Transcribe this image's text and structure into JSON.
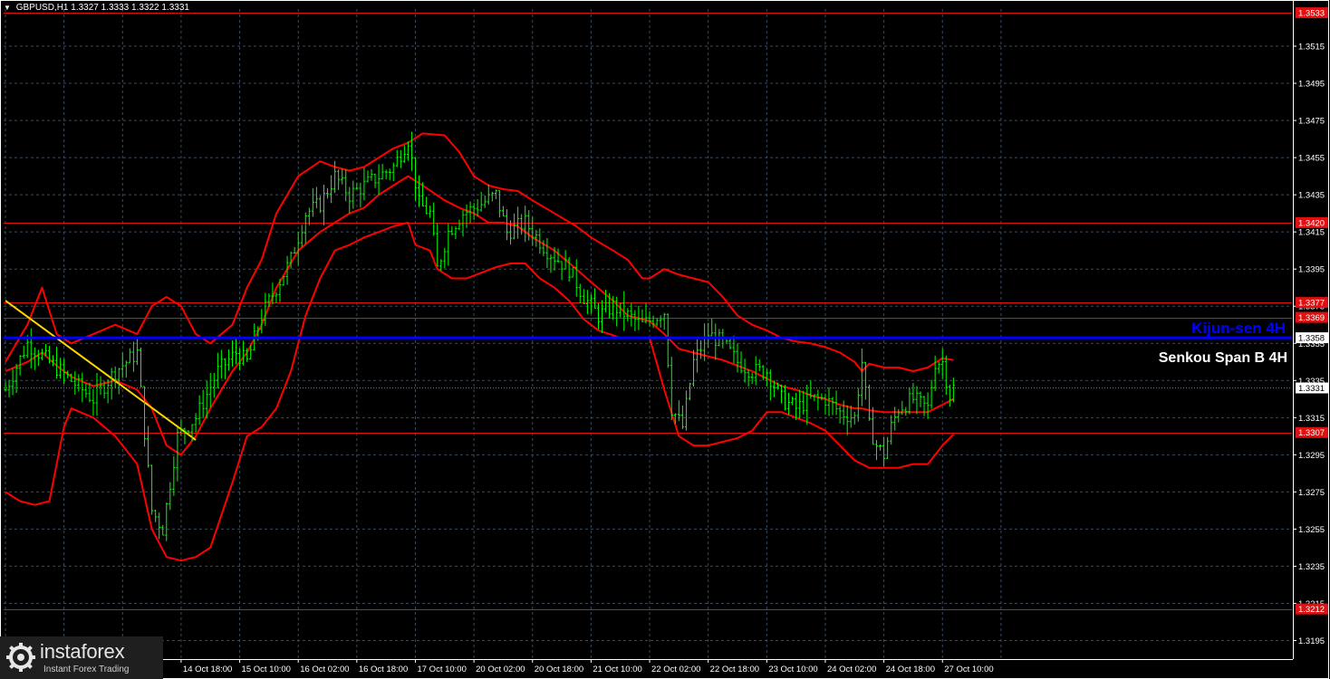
{
  "header": {
    "symbol": "GBPUSD,H1",
    "ohlc": "1.3327 1.3333 1.3322 1.3331"
  },
  "logo": {
    "name": "instaforex",
    "tagline": "Instant Forex Trading"
  },
  "chart_data": {
    "type": "candlestick",
    "symbol": "GBPUSD",
    "timeframe": "H1",
    "ylim": [
      1.3185,
      1.3535
    ],
    "grid": true,
    "background": "#000000",
    "colors": {
      "candles": "#00ff00",
      "indicator": "#ff0000",
      "level": "#e01010",
      "kijun": "#0000ff",
      "trendline": "#ffd700",
      "grid": "#3c4a5a",
      "axis_text": "#ffffff",
      "level_label_bg": "#e01010",
      "current_label_bg": "#ffffff"
    },
    "y_ticks": [
      "1.3195",
      "1.3215",
      "1.3235",
      "1.3255",
      "1.3275",
      "1.3295",
      "1.3315",
      "1.3335",
      "1.3355",
      "1.3375",
      "1.3395",
      "1.3415",
      "1.3435",
      "1.3455",
      "1.3475",
      "1.3495",
      "1.3515"
    ],
    "x_labels": [
      {
        "label": "14 Oct 18:00",
        "bar": 48
      },
      {
        "label": "15 Oct 10:00",
        "bar": 64
      },
      {
        "label": "16 Oct 02:00",
        "bar": 80
      },
      {
        "label": "16 Oct 18:00",
        "bar": 96
      },
      {
        "label": "17 Oct 10:00",
        "bar": 112
      },
      {
        "label": "20 Oct 02:00",
        "bar": 128
      },
      {
        "label": "20 Oct 18:00",
        "bar": 144
      },
      {
        "label": "21 Oct 10:00",
        "bar": 160
      },
      {
        "label": "22 Oct 02:00",
        "bar": 176
      },
      {
        "label": "22 Oct 18:00",
        "bar": 192
      },
      {
        "label": "23 Oct 10:00",
        "bar": 208
      },
      {
        "label": "24 Oct 02:00",
        "bar": 224
      },
      {
        "label": "24 Oct 18:00",
        "bar": 240
      },
      {
        "label": "27 Oct 10:00",
        "bar": 256
      }
    ],
    "levels": [
      {
        "price": 1.3533,
        "label": "1.3533"
      },
      {
        "price": 1.342,
        "label": "1.3420"
      },
      {
        "price": 1.3377,
        "label": "1.3377"
      },
      {
        "price": 1.3369,
        "label": "1.3369"
      },
      {
        "price": 1.3307,
        "label": "1.3307"
      },
      {
        "price": 1.3212,
        "label": "1.3212"
      }
    ],
    "current_price": {
      "price": 1.3331,
      "label": "1.3331"
    },
    "kijun": {
      "price": 1.3358,
      "label": "1.3358"
    },
    "annotations": [
      "Kijun-sen 4H",
      "Senkou Span B 4H"
    ],
    "price_path": [
      [
        0,
        1.333
      ],
      [
        6,
        1.3355
      ],
      [
        12,
        1.3345
      ],
      [
        18,
        1.3335
      ],
      [
        24,
        1.3325
      ],
      [
        30,
        1.334
      ],
      [
        36,
        1.335
      ],
      [
        40,
        1.3265
      ],
      [
        43,
        1.3255
      ],
      [
        47,
        1.3305
      ],
      [
        52,
        1.3315
      ],
      [
        58,
        1.334
      ],
      [
        63,
        1.335
      ],
      [
        66,
        1.3345
      ],
      [
        70,
        1.337
      ],
      [
        74,
        1.3385
      ],
      [
        78,
        1.34
      ],
      [
        82,
        1.3425
      ],
      [
        86,
        1.343
      ],
      [
        90,
        1.3445
      ],
      [
        94,
        1.3435
      ],
      [
        98,
        1.344
      ],
      [
        102,
        1.3445
      ],
      [
        106,
        1.345
      ],
      [
        110,
        1.3465
      ],
      [
        113,
        1.343
      ],
      [
        116,
        1.3425
      ],
      [
        118,
        1.3395
      ],
      [
        121,
        1.3415
      ],
      [
        125,
        1.3425
      ],
      [
        130,
        1.343
      ],
      [
        134,
        1.3435
      ],
      [
        137,
        1.3415
      ],
      [
        142,
        1.342
      ],
      [
        148,
        1.3405
      ],
      [
        154,
        1.3395
      ],
      [
        158,
        1.338
      ],
      [
        162,
        1.337
      ],
      [
        166,
        1.3375
      ],
      [
        170,
        1.337
      ],
      [
        174,
        1.3365
      ],
      [
        180,
        1.3372
      ],
      [
        182,
        1.332
      ],
      [
        185,
        1.331
      ],
      [
        188,
        1.3345
      ],
      [
        192,
        1.336
      ],
      [
        196,
        1.3355
      ],
      [
        200,
        1.3345
      ],
      [
        204,
        1.334
      ],
      [
        208,
        1.334
      ],
      [
        212,
        1.3325
      ],
      [
        216,
        1.332
      ],
      [
        220,
        1.3325
      ],
      [
        224,
        1.3325
      ],
      [
        228,
        1.3318
      ],
      [
        232,
        1.3315
      ],
      [
        234,
        1.3345
      ],
      [
        236,
        1.331
      ],
      [
        238,
        1.33
      ],
      [
        240,
        1.3295
      ],
      [
        242,
        1.331
      ],
      [
        244,
        1.332
      ],
      [
        248,
        1.3325
      ],
      [
        252,
        1.332
      ],
      [
        254,
        1.3345
      ],
      [
        256,
        1.3345
      ],
      [
        258,
        1.3327
      ],
      [
        259,
        1.3331
      ]
    ],
    "bands": {
      "upper": [
        [
          0,
          1.3345
        ],
        [
          6,
          1.3365
        ],
        [
          10,
          1.3385
        ],
        [
          14,
          1.336
        ],
        [
          18,
          1.3355
        ],
        [
          24,
          1.336
        ],
        [
          30,
          1.3365
        ],
        [
          36,
          1.336
        ],
        [
          40,
          1.3375
        ],
        [
          44,
          1.338
        ],
        [
          48,
          1.3375
        ],
        [
          52,
          1.336
        ],
        [
          56,
          1.3355
        ],
        [
          62,
          1.3365
        ],
        [
          66,
          1.3385
        ],
        [
          70,
          1.34
        ],
        [
          74,
          1.3425
        ],
        [
          80,
          1.3445
        ],
        [
          86,
          1.3453
        ],
        [
          90,
          1.345
        ],
        [
          94,
          1.3448
        ],
        [
          98,
          1.345
        ],
        [
          102,
          1.3455
        ],
        [
          106,
          1.346
        ],
        [
          110,
          1.3463
        ],
        [
          114,
          1.3468
        ],
        [
          120,
          1.3467
        ],
        [
          124,
          1.3458
        ],
        [
          128,
          1.3445
        ],
        [
          132,
          1.344
        ],
        [
          136,
          1.3438
        ],
        [
          140,
          1.3437
        ],
        [
          144,
          1.3432
        ],
        [
          150,
          1.3425
        ],
        [
          156,
          1.3418
        ],
        [
          160,
          1.3412
        ],
        [
          166,
          1.3405
        ],
        [
          170,
          1.34
        ],
        [
          174,
          1.339
        ],
        [
          176,
          1.339
        ],
        [
          180,
          1.3395
        ],
        [
          184,
          1.3392
        ],
        [
          188,
          1.339
        ],
        [
          192,
          1.3388
        ],
        [
          196,
          1.338
        ],
        [
          200,
          1.337
        ],
        [
          204,
          1.3365
        ],
        [
          208,
          1.3362
        ],
        [
          212,
          1.3358
        ],
        [
          216,
          1.3356
        ],
        [
          220,
          1.3355
        ],
        [
          224,
          1.3353
        ],
        [
          228,
          1.335
        ],
        [
          232,
          1.3345
        ],
        [
          234,
          1.334
        ],
        [
          236,
          1.3344
        ],
        [
          240,
          1.3342
        ],
        [
          244,
          1.3342
        ],
        [
          248,
          1.334
        ],
        [
          252,
          1.3342
        ],
        [
          256,
          1.3347
        ],
        [
          259,
          1.3346
        ]
      ],
      "middle": [
        [
          0,
          1.334
        ],
        [
          6,
          1.3345
        ],
        [
          10,
          1.335
        ],
        [
          14,
          1.3343
        ],
        [
          18,
          1.3337
        ],
        [
          24,
          1.3332
        ],
        [
          30,
          1.3335
        ],
        [
          36,
          1.333
        ],
        [
          40,
          1.332
        ],
        [
          44,
          1.33
        ],
        [
          48,
          1.3295
        ],
        [
          52,
          1.3305
        ],
        [
          56,
          1.332
        ],
        [
          62,
          1.334
        ],
        [
          66,
          1.335
        ],
        [
          70,
          1.3365
        ],
        [
          74,
          1.3385
        ],
        [
          80,
          1.3405
        ],
        [
          86,
          1.3415
        ],
        [
          90,
          1.342
        ],
        [
          94,
          1.3425
        ],
        [
          98,
          1.3428
        ],
        [
          102,
          1.3435
        ],
        [
          106,
          1.344
        ],
        [
          110,
          1.3445
        ],
        [
          114,
          1.344
        ],
        [
          120,
          1.3432
        ],
        [
          124,
          1.3428
        ],
        [
          128,
          1.3425
        ],
        [
          132,
          1.342
        ],
        [
          136,
          1.342
        ],
        [
          140,
          1.3418
        ],
        [
          144,
          1.3412
        ],
        [
          150,
          1.3405
        ],
        [
          156,
          1.3395
        ],
        [
          160,
          1.3388
        ],
        [
          166,
          1.3378
        ],
        [
          170,
          1.337
        ],
        [
          174,
          1.3368
        ],
        [
          176,
          1.3367
        ],
        [
          180,
          1.336
        ],
        [
          184,
          1.3352
        ],
        [
          188,
          1.335
        ],
        [
          192,
          1.3348
        ],
        [
          196,
          1.3346
        ],
        [
          200,
          1.3343
        ],
        [
          204,
          1.334
        ],
        [
          208,
          1.3336
        ],
        [
          212,
          1.3332
        ],
        [
          216,
          1.333
        ],
        [
          220,
          1.3327
        ],
        [
          224,
          1.3325
        ],
        [
          228,
          1.3322
        ],
        [
          232,
          1.332
        ],
        [
          234,
          1.332
        ],
        [
          236,
          1.3319
        ],
        [
          240,
          1.3318
        ],
        [
          244,
          1.3318
        ],
        [
          248,
          1.3318
        ],
        [
          252,
          1.3318
        ],
        [
          256,
          1.3322
        ],
        [
          259,
          1.3325
        ]
      ],
      "lower": [
        [
          0,
          1.3275
        ],
        [
          4,
          1.327
        ],
        [
          8,
          1.3268
        ],
        [
          12,
          1.327
        ],
        [
          16,
          1.331
        ],
        [
          18,
          1.332
        ],
        [
          24,
          1.3315
        ],
        [
          30,
          1.3305
        ],
        [
          36,
          1.329
        ],
        [
          40,
          1.3255
        ],
        [
          44,
          1.324
        ],
        [
          48,
          1.3238
        ],
        [
          52,
          1.324
        ],
        [
          56,
          1.3245
        ],
        [
          62,
          1.328
        ],
        [
          66,
          1.3305
        ],
        [
          70,
          1.331
        ],
        [
          74,
          1.332
        ],
        [
          78,
          1.334
        ],
        [
          82,
          1.337
        ],
        [
          86,
          1.339
        ],
        [
          90,
          1.3405
        ],
        [
          94,
          1.3408
        ],
        [
          98,
          1.3412
        ],
        [
          102,
          1.3415
        ],
        [
          106,
          1.3418
        ],
        [
          110,
          1.342
        ],
        [
          112,
          1.3408
        ],
        [
          116,
          1.3405
        ],
        [
          118,
          1.3395
        ],
        [
          122,
          1.339
        ],
        [
          126,
          1.339
        ],
        [
          130,
          1.3393
        ],
        [
          134,
          1.3396
        ],
        [
          138,
          1.3398
        ],
        [
          142,
          1.3398
        ],
        [
          146,
          1.339
        ],
        [
          150,
          1.3385
        ],
        [
          154,
          1.3378
        ],
        [
          158,
          1.3368
        ],
        [
          162,
          1.3362
        ],
        [
          168,
          1.3358
        ],
        [
          172,
          1.3358
        ],
        [
          176,
          1.3358
        ],
        [
          180,
          1.333
        ],
        [
          184,
          1.3305
        ],
        [
          188,
          1.33
        ],
        [
          192,
          1.33
        ],
        [
          196,
          1.3302
        ],
        [
          200,
          1.3304
        ],
        [
          204,
          1.3308
        ],
        [
          208,
          1.3318
        ],
        [
          212,
          1.3318
        ],
        [
          216,
          1.3315
        ],
        [
          220,
          1.3312
        ],
        [
          224,
          1.3308
        ],
        [
          228,
          1.33
        ],
        [
          232,
          1.3292
        ],
        [
          236,
          1.3288
        ],
        [
          240,
          1.3288
        ],
        [
          244,
          1.3288
        ],
        [
          248,
          1.329
        ],
        [
          252,
          1.329
        ],
        [
          256,
          1.33
        ],
        [
          259,
          1.3306
        ]
      ]
    },
    "trendline": [
      [
        0,
        1.3378
      ],
      [
        52,
        1.3303
      ]
    ]
  }
}
